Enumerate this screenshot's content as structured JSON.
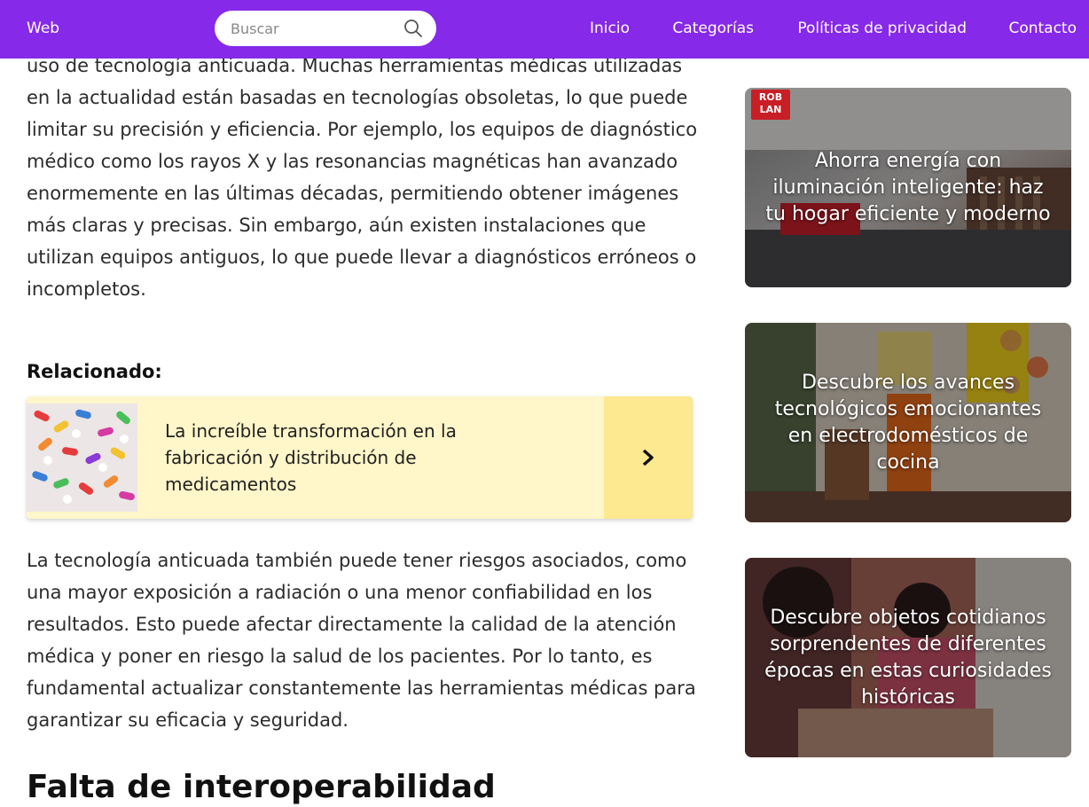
{
  "header": {
    "brand": "Web",
    "search_placeholder": "Buscar",
    "nav": [
      "Inicio",
      "Categorías",
      "Políticas de privacidad",
      "Contacto"
    ]
  },
  "article": {
    "paragraph1": "uso de tecnología anticuada. Muchas herramientas médicas utilizadas en la actualidad están basadas en tecnologías obsoletas, lo que puede limitar su precisión y eficiencia. Por ejemplo, los equipos de diagnóstico médico como los rayos X y las resonancias magnéticas han avanzado enormemente en las últimas décadas, permitiendo obtener imágenes más claras y precisas. Sin embargo, aún existen instalaciones que utilizan equipos antiguos, lo que puede llevar a diagnósticos erróneos o incompletos.",
    "related_heading": "Relacionado:",
    "related_title": "La increíble transformación en la fabricación y distribución de medicamentos",
    "paragraph2": "La tecnología anticuada también puede tener riesgos asociados, como una mayor exposición a radiación o una menor confiabilidad en los resultados. Esto puede afectar directamente la calidad de la atención médica y poner en riesgo la salud de los pacientes. Por lo tanto, es fundamental actualizar constantemente las herramientas médicas para garantizar su eficacia y seguridad.",
    "next_heading_partial": "Falta de interoperabilidad"
  },
  "sidebar": {
    "cards": [
      {
        "title": "Ahorra energía con iluminación inteligente: haz tu hogar eficiente y moderno",
        "badge": "ROB LAN"
      },
      {
        "title": "Descubre los avances tecnológicos emocionantes en electrodomésticos de cocina"
      },
      {
        "title": "Descubre objetos cotidianos sorprendentes de diferentes épocas en estas curiosidades históricas"
      }
    ]
  },
  "colors": {
    "header": "#8629e8",
    "related_bg": "#fff6c9",
    "related_arrow_bg": "#fde98f"
  }
}
